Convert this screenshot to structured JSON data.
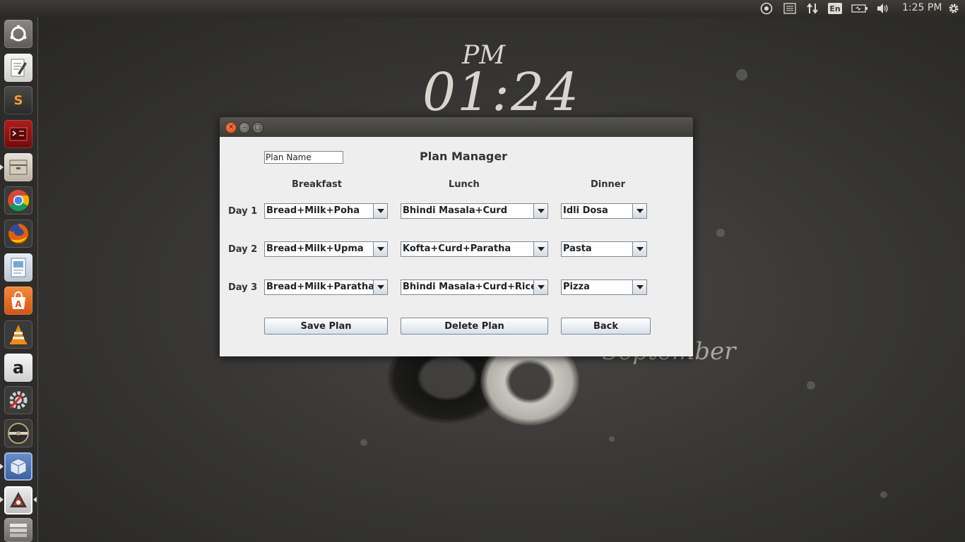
{
  "top_panel": {
    "language": "En",
    "clock": "1:25 PM",
    "icons": [
      "chrome-indicator-icon",
      "list-icon",
      "network-icon",
      "keyboard-language-icon",
      "battery-icon",
      "volume-icon",
      "settings-gear-icon"
    ]
  },
  "launcher": {
    "items": [
      "dash-home-icon",
      "text-editor-icon",
      "sublime-text-icon",
      "terminal-icon",
      "files-icon",
      "chrome-icon",
      "firefox-icon",
      "document-viewer-icon",
      "software-center-icon",
      "vlc-icon",
      "amazon-icon",
      "system-settings-icon",
      "disk-icon",
      "virtualbox-icon",
      "java-app-icon",
      "workspaces-icon"
    ]
  },
  "wallpaper": {
    "ampm": "PM",
    "time": "01:24",
    "month": "September"
  },
  "window": {
    "plan_name_value": "Plan Name",
    "title": "Plan Manager",
    "columns": [
      "Breakfast",
      "Lunch",
      "Dinner"
    ],
    "days": [
      {
        "label": "Day 1",
        "breakfast": "Bread+Milk+Poha",
        "lunch": "Bhindi Masala+Curd",
        "dinner": "Idli Dosa"
      },
      {
        "label": "Day 2",
        "breakfast": "Bread+Milk+Upma",
        "lunch": "Kofta+Curd+Paratha",
        "dinner": "Pasta"
      },
      {
        "label": "Day 3",
        "breakfast": "Bread+Milk+Paratha",
        "lunch": "Bhindi Masala+Curd+Rice",
        "dinner": "Pizza"
      }
    ],
    "buttons": {
      "save": "Save Plan",
      "delete": "Delete Plan",
      "back": "Back"
    }
  }
}
